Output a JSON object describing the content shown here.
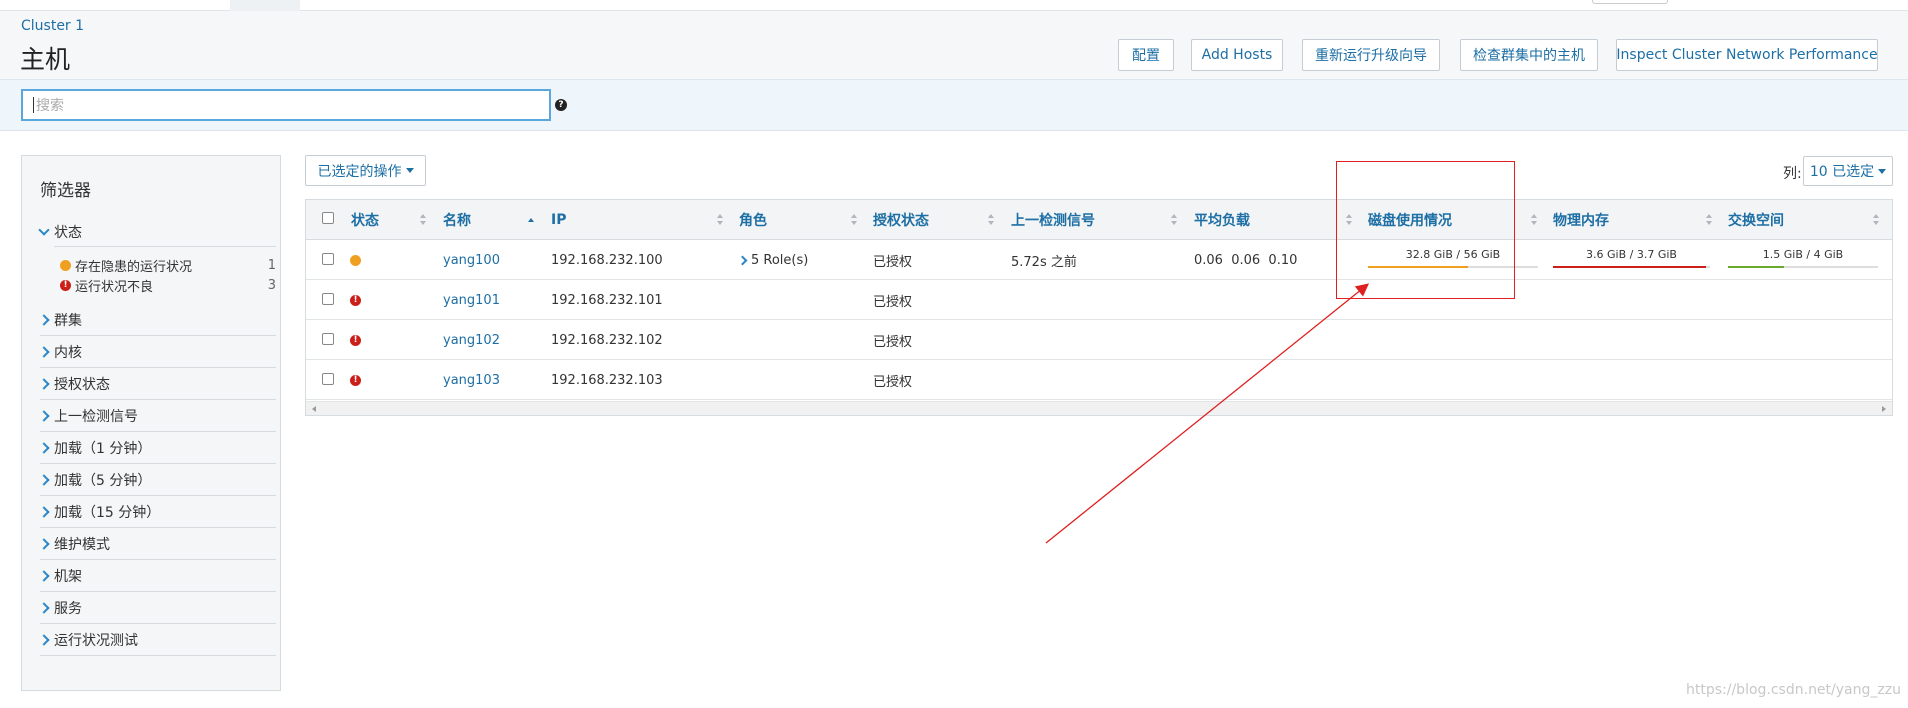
{
  "header": {
    "breadcrumb": "Cluster 1",
    "title": "主机",
    "buttons": [
      "配置",
      "Add Hosts",
      "重新运行升级向导",
      "检查群集中的主机",
      "Inspect Cluster Network Performance"
    ]
  },
  "search": {
    "placeholder": "搜索"
  },
  "filters": {
    "title": "筛选器",
    "status_group": "状态",
    "status_items": [
      {
        "label": "存在隐患的运行状况",
        "count": "1",
        "icon": "warning-dot-icon"
      },
      {
        "label": "运行状况不良",
        "count": "3",
        "icon": "error-dot-icon"
      }
    ],
    "groups": [
      "群集",
      "内核",
      "授权状态",
      "上一检测信号",
      "加载（1 分钟）",
      "加载（5 分钟）",
      "加载（15 分钟）",
      "维护模式",
      "机架",
      "服务",
      "运行状况测试"
    ]
  },
  "toolbar": {
    "actions_label": "已选定的操作",
    "columns_label": "列:",
    "columns_selected": "10 已选定"
  },
  "table": {
    "headers": [
      "状态",
      "名称",
      "IP",
      "角色",
      "授权状态",
      "上一检测信号",
      "平均负载",
      "磁盘使用情况",
      "物理内存",
      "交换空间"
    ],
    "rows": [
      {
        "status": "warning",
        "name": "yang100",
        "ip": "192.168.232.100",
        "roles": "5 Role(s)",
        "license": "已授权",
        "heartbeat": "5.72s 之前",
        "load": "0.06  0.06  0.10",
        "disk": "32.8 GiB / 56 GiB",
        "disk_frac": 0.586,
        "memory": "3.6 GiB / 3.7 GiB",
        "memory_frac": 0.973,
        "swap": "1.5 GiB / 4 GiB",
        "swap_frac": 0.375
      },
      {
        "status": "bad",
        "name": "yang101",
        "ip": "192.168.232.101",
        "roles": "",
        "license": "已授权",
        "heartbeat": "",
        "load": ""
      },
      {
        "status": "bad",
        "name": "yang102",
        "ip": "192.168.232.102",
        "roles": "",
        "license": "已授权",
        "heartbeat": "",
        "load": ""
      },
      {
        "status": "bad",
        "name": "yang103",
        "ip": "192.168.232.103",
        "roles": "",
        "license": "已授权",
        "heartbeat": "",
        "load": ""
      }
    ]
  },
  "colors": {
    "accent": "#1d6fa5",
    "warning": "#f0a020",
    "error": "#cc1f1a",
    "disk_bar": "#f0a020",
    "memory_bar": "#cc1f1a",
    "swap_bar": "#6aaa2a",
    "annotation": "#e02020"
  },
  "watermark": "https://blog.csdn.net/yang_zzu"
}
